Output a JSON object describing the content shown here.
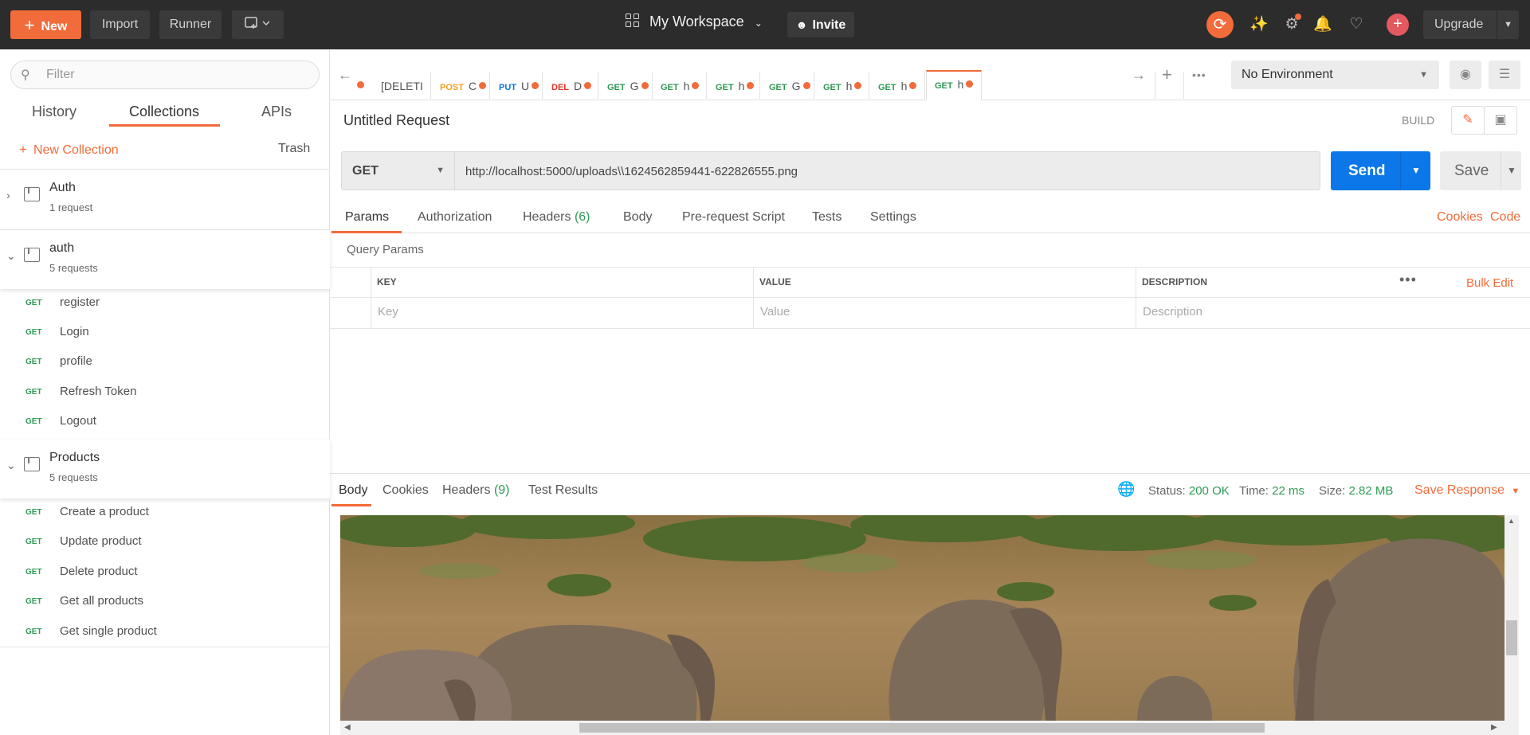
{
  "topbar": {
    "new_label": "New",
    "import_label": "Import",
    "runner_label": "Runner",
    "workspace": "My Workspace",
    "invite_label": "Invite",
    "upgrade_label": "Upgrade",
    "accent": "#f26b3a"
  },
  "sidebar": {
    "filter_placeholder": "Filter",
    "tabs": [
      "History",
      "Collections",
      "APIs"
    ],
    "active_tab": "Collections",
    "new_collection": "New Collection",
    "trash": "Trash",
    "collections": [
      {
        "name": "Auth",
        "count": "1 request",
        "expanded": false,
        "requests": []
      },
      {
        "name": "auth",
        "count": "5 requests",
        "expanded": true,
        "requests": [
          {
            "method": "GET",
            "name": "register"
          },
          {
            "method": "GET",
            "name": "Login"
          },
          {
            "method": "GET",
            "name": "profile"
          },
          {
            "method": "GET",
            "name": "Refresh Token"
          },
          {
            "method": "GET",
            "name": "Logout"
          }
        ]
      },
      {
        "name": "Products",
        "count": "5 requests",
        "expanded": true,
        "requests": [
          {
            "method": "GET",
            "name": "Create a product"
          },
          {
            "method": "GET",
            "name": "Update product"
          },
          {
            "method": "GET",
            "name": "Delete product"
          },
          {
            "method": "GET",
            "name": "Get all products"
          },
          {
            "method": "GET",
            "name": "Get single product"
          }
        ]
      }
    ]
  },
  "request_tabs": [
    {
      "method": "",
      "name": "[DELETI",
      "color": "#555555"
    },
    {
      "method": "POST",
      "name": "C",
      "color": "#f4a01c"
    },
    {
      "method": "PUT",
      "name": "U",
      "color": "#0b77e8"
    },
    {
      "method": "DEL",
      "name": "D",
      "color": "#e5352b"
    },
    {
      "method": "GET",
      "name": "G",
      "color": "#2f9a55"
    },
    {
      "method": "GET",
      "name": "h",
      "color": "#2f9a55"
    },
    {
      "method": "GET",
      "name": "h",
      "color": "#2f9a55"
    },
    {
      "method": "GET",
      "name": "G",
      "color": "#2f9a55"
    },
    {
      "method": "GET",
      "name": "h",
      "color": "#2f9a55"
    },
    {
      "method": "GET",
      "name": "h",
      "color": "#2f9a55"
    },
    {
      "method": "GET",
      "name": "h",
      "color": "#2f9a55"
    }
  ],
  "environment": "No Environment",
  "request": {
    "title": "Untitled Request",
    "mode": "BUILD",
    "method": "GET",
    "url": "http://localhost:5000/uploads\\\\1624562859441-622826555.png",
    "send_label": "Send",
    "save_label": "Save"
  },
  "request_subtabs": [
    {
      "label": "Params",
      "count": ""
    },
    {
      "label": "Authorization",
      "count": ""
    },
    {
      "label": "Headers",
      "count": "(6)"
    },
    {
      "label": "Body",
      "count": ""
    },
    {
      "label": "Pre-request Script",
      "count": ""
    },
    {
      "label": "Tests",
      "count": ""
    },
    {
      "label": "Settings",
      "count": ""
    }
  ],
  "links": {
    "cookies": "Cookies",
    "code": "Code"
  },
  "params": {
    "title": "Query Params",
    "headers": [
      "KEY",
      "VALUE",
      "DESCRIPTION"
    ],
    "placeholders": [
      "Key",
      "Value",
      "Description"
    ],
    "bulk_edit": "Bulk Edit"
  },
  "response": {
    "tabs": [
      {
        "label": "Body",
        "count": ""
      },
      {
        "label": "Cookies",
        "count": ""
      },
      {
        "label": "Headers",
        "count": "(9)"
      },
      {
        "label": "Test Results",
        "count": ""
      }
    ],
    "status_label": "Status:",
    "status": "200 OK",
    "time_label": "Time:",
    "time": "22 ms",
    "size_label": "Size:",
    "size": "2.82 MB",
    "save_response": "Save Response"
  }
}
